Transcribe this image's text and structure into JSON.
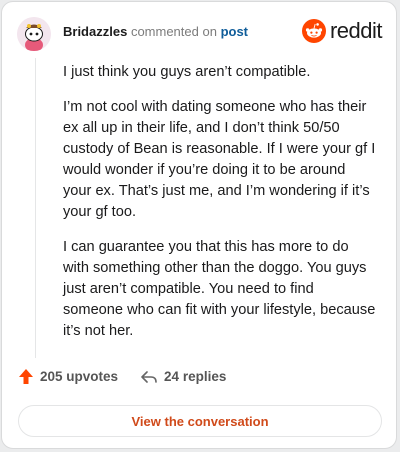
{
  "header": {
    "username": "Bridazzles",
    "action_text": "commented on",
    "post_link": "post",
    "brand": "reddit"
  },
  "comment": {
    "paragraphs": [
      "I just think you guys aren’t compatible.",
      "I’m not cool with dating someone who has their ex all up in their life, and I don’t think 50/50 custody of Bean is reasonable. If I were your gf I would wonder if you’re doing it to be around your ex. That’s just me, and I’m wondering if it’s your gf too.",
      "I can guarantee you that this has more to do with something other than the doggo. You guys just aren’t compatible. You need to find someone who can fit with your lifestyle, because it’s not her."
    ]
  },
  "actions": {
    "upvotes": "205 upvotes",
    "replies": "24 replies"
  },
  "cta": {
    "label": "View the conversation"
  },
  "colors": {
    "brand_orange": "#ff4500",
    "link_blue": "#0f5d9a",
    "cta_text": "#d04a1a"
  },
  "icons": {
    "avatar": "snoo-avatar",
    "logo": "reddit-snoo-icon",
    "upvote": "upvote-arrow-icon",
    "reply": "reply-arrow-icon"
  }
}
